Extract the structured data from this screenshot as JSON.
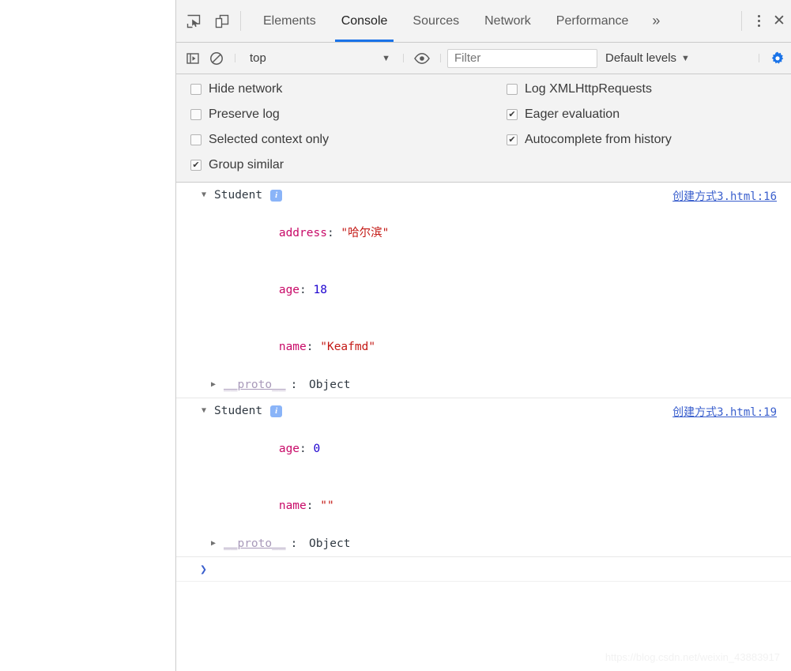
{
  "devtools": {
    "tabstrip": {
      "inspect_icon": "inspect-element-icon",
      "device_icon": "device-toolbar-icon",
      "tabs": [
        {
          "label": "Elements",
          "active": false
        },
        {
          "label": "Console",
          "active": true
        },
        {
          "label": "Sources",
          "active": false
        },
        {
          "label": "Network",
          "active": false
        },
        {
          "label": "Performance",
          "active": false
        }
      ],
      "more_tabs_label": "»",
      "menu_icon": "more-options-icon",
      "close_label": "✕"
    },
    "console_toolbar": {
      "sidebar_icon": "console-sidebar-icon",
      "clear_icon": "clear-console-icon",
      "context_value": "top",
      "context_caret": "▼",
      "eye_icon": "live-expression-eye-icon",
      "filter_placeholder": "Filter",
      "filter_value": "",
      "levels_label": "Default levels",
      "levels_caret": "▼",
      "settings_icon": "settings-gear-icon"
    },
    "settings": {
      "left": [
        {
          "label": "Hide network",
          "checked": false
        },
        {
          "label": "Preserve log",
          "checked": false
        },
        {
          "label": "Selected context only",
          "checked": false
        },
        {
          "label": "Group similar",
          "checked": true
        }
      ],
      "right": [
        {
          "label": "Log XMLHttpRequests",
          "checked": false
        },
        {
          "label": "Eager evaluation",
          "checked": true
        },
        {
          "label": "Autocomplete from history",
          "checked": true
        }
      ]
    },
    "console_messages": [
      {
        "expander": "▼",
        "object_name": "Student",
        "badge": "i",
        "source": "创建方式3.html:16",
        "props": [
          {
            "key": "address",
            "sep": ": ",
            "value": "\"哈尔滨\"",
            "type": "string"
          },
          {
            "key": "age",
            "sep": ": ",
            "value": "18",
            "type": "number"
          },
          {
            "key": "name",
            "sep": ": ",
            "value": "\"Keafmd\"",
            "type": "string"
          }
        ],
        "proto": {
          "expander": "▶",
          "key": "__proto__",
          "sep": ": ",
          "value": "Object"
        }
      },
      {
        "expander": "▼",
        "object_name": "Student",
        "badge": "i",
        "source": "创建方式3.html:19",
        "props": [
          {
            "key": "age",
            "sep": ": ",
            "value": "0",
            "type": "number"
          },
          {
            "key": "name",
            "sep": ": ",
            "value": "\"\"",
            "type": "string"
          }
        ],
        "proto": {
          "expander": "▶",
          "key": "__proto__",
          "sep": ": ",
          "value": "Object"
        }
      }
    ],
    "prompt": {
      "chevron": "❯",
      "value": ""
    },
    "watermark": "https://blog.csdn.net/weixin_43883917"
  },
  "colors": {
    "accent": "#1a73e8",
    "string": "#c41a16",
    "number": "#1c00cf",
    "key": "#c80a68",
    "link": "#3a5fcd",
    "badge": "#8ab4f8"
  }
}
